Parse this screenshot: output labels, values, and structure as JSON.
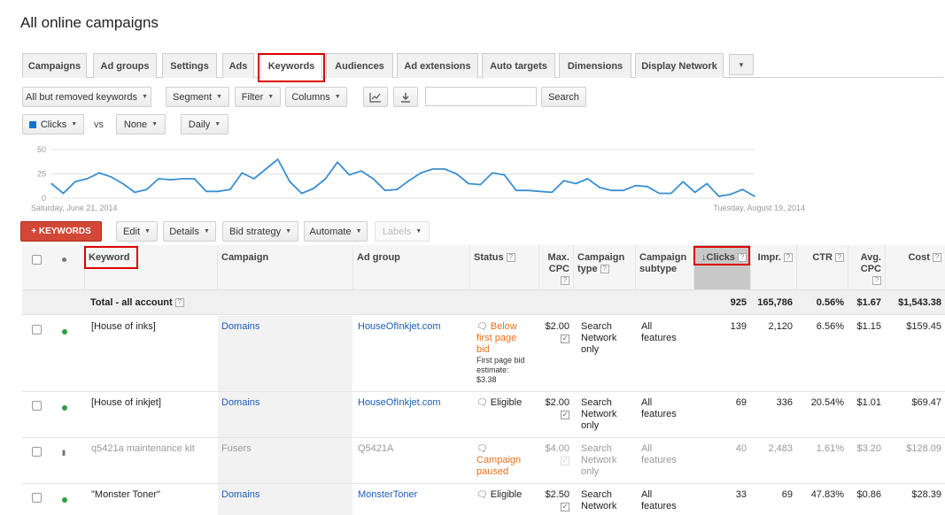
{
  "page": {
    "title": "All online campaigns"
  },
  "tabs": [
    "Campaigns",
    "Ad groups",
    "Settings",
    "Ads",
    "Keywords",
    "Audiences",
    "Ad extensions",
    "Auto targets",
    "Dimensions",
    "Display Network"
  ],
  "tabs_more": "▼",
  "toolbar": {
    "filter_scope": "All but removed keywords",
    "segment": "Segment",
    "filter": "Filter",
    "columns": "Columns",
    "chart_icon": "line-chart-icon",
    "download_icon": "download-icon",
    "search_value": "",
    "search_button": "Search"
  },
  "metric_bar": {
    "metric1": "Clicks",
    "metric1_color": "#1a73c8",
    "vs": "vs",
    "metric2": "None",
    "period": "Daily"
  },
  "chart_data": {
    "type": "line",
    "series": [
      {
        "name": "Clicks",
        "values": [
          15,
          5,
          17,
          20,
          26,
          22,
          15,
          6,
          9,
          20,
          19,
          20,
          20,
          7,
          7,
          9,
          26,
          20,
          30,
          40,
          17,
          5,
          10,
          20,
          37,
          24,
          28,
          20,
          8,
          9,
          18,
          26,
          30,
          30,
          25,
          15,
          14,
          26,
          24,
          8,
          8,
          7,
          6,
          18,
          15,
          20,
          11,
          8,
          8,
          13,
          12,
          5,
          5,
          17,
          6,
          15,
          2,
          4,
          9,
          2
        ]
      }
    ],
    "ylim": [
      0,
      50
    ],
    "yticks": [
      "50",
      "25",
      "0"
    ],
    "x_start_label": "Saturday, June 21, 2014",
    "x_end_label": "Tuesday, August 19, 2014",
    "grid": true,
    "color": "#3b8fd1"
  },
  "actions": {
    "add_keywords": "+ KEYWORDS",
    "edit": "Edit",
    "details": "Details",
    "bid_strategy": "Bid strategy",
    "automate": "Automate",
    "labels": "Labels"
  },
  "table": {
    "headers": {
      "keyword": "Keyword",
      "campaign": "Campaign",
      "ad_group": "Ad group",
      "status": "Status",
      "max_cpc_1": "Max.",
      "max_cpc_2": "CPC",
      "campaign_type_1": "Campaign",
      "campaign_type_2": "type",
      "campaign_subtype_1": "Campaign",
      "campaign_subtype_2": "subtype",
      "clicks": "↓Clicks",
      "impr": "Impr.",
      "ctr": "CTR",
      "avg_cpc_1": "Avg.",
      "avg_cpc_2": "CPC",
      "cost": "Cost",
      "help": "?"
    },
    "total": {
      "label": "Total - all account",
      "clicks": "925",
      "impr": "165,786",
      "ctr": "0.56%",
      "avg_cpc": "$1.67",
      "cost": "$1,543.38"
    },
    "rows": [
      {
        "keyword": "[House of inks]",
        "campaign": "Domains",
        "ad_group": "HouseOfInkjet.com",
        "status_1": "Below",
        "status_2": "first page",
        "status_3": "bid",
        "status_note_1": "First page bid",
        "status_note_2": "estimate:",
        "status_note_3": "$3.38",
        "max_cpc": "$2.00",
        "type_1": "Search",
        "type_2": "Network",
        "type_3": "only",
        "subtype_1": "All",
        "subtype_2": "features",
        "clicks": "139",
        "impr": "2,120",
        "ctr": "6.56%",
        "avg_cpc": "$1.15",
        "cost": "$159.45"
      },
      {
        "keyword": "[House of inkjet]",
        "campaign": "Domains",
        "ad_group": "HouseOfInkjet.com",
        "status_1": "Eligible",
        "max_cpc": "$2.00",
        "type_1": "Search",
        "type_2": "Network",
        "type_3": "only",
        "subtype_1": "All",
        "subtype_2": "features",
        "clicks": "69",
        "impr": "336",
        "ctr": "20.54%",
        "avg_cpc": "$1.01",
        "cost": "$69.47"
      },
      {
        "keyword": "q5421a maintenance kit",
        "campaign": "Fusers",
        "ad_group": "Q5421A",
        "status_1": "Campaign",
        "status_2": "paused",
        "max_cpc": "$4.00",
        "type_1": "Search",
        "type_2": "Network",
        "type_3": "only",
        "subtype_1": "All",
        "subtype_2": "features",
        "clicks": "40",
        "impr": "2,483",
        "ctr": "1.61%",
        "avg_cpc": "$3.20",
        "cost": "$128.09"
      },
      {
        "keyword": "\"Monster Toner\"",
        "campaign": "Domains",
        "ad_group": "MonsterToner",
        "status_1": "Eligible",
        "max_cpc": "$2.50",
        "type_1": "Search",
        "type_2": "Network",
        "subtype_1": "All",
        "subtype_2": "features",
        "clicks": "33",
        "impr": "69",
        "ctr": "47.83%",
        "avg_cpc": "$0.86",
        "cost": "$28.39"
      }
    ]
  }
}
